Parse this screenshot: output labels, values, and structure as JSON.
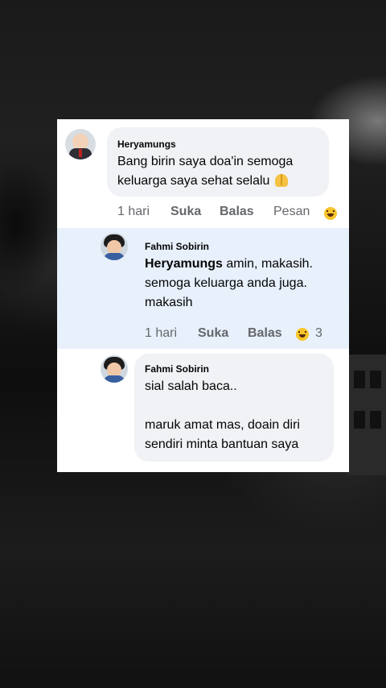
{
  "comments": [
    {
      "author": "Heryamungs",
      "text_line1": "Bang birin saya doa'in semoga",
      "text_line2": "keluarga saya sehat selalu",
      "time": "1 hari",
      "like": "Suka",
      "reply": "Balas",
      "message": "Pesan"
    },
    {
      "author": "Fahmi Sobirin",
      "mention": "Heryamungs",
      "text_line1_rest": " amin, makasih.",
      "text_line2": "semoga keluarga anda juga.",
      "text_line3": "makasih",
      "time": "1 hari",
      "like": "Suka",
      "reply": "Balas",
      "reaction_count": "3"
    },
    {
      "author": "Fahmi Sobirin",
      "text_line1": "sial salah baca..",
      "text_line2": "maruk amat mas, doain diri",
      "text_line3": "sendiri minta bantuan saya"
    }
  ],
  "colors": {
    "reply_highlight": "#e7f0fb",
    "bubble": "#f0f2f5",
    "meta": "#65676b"
  }
}
